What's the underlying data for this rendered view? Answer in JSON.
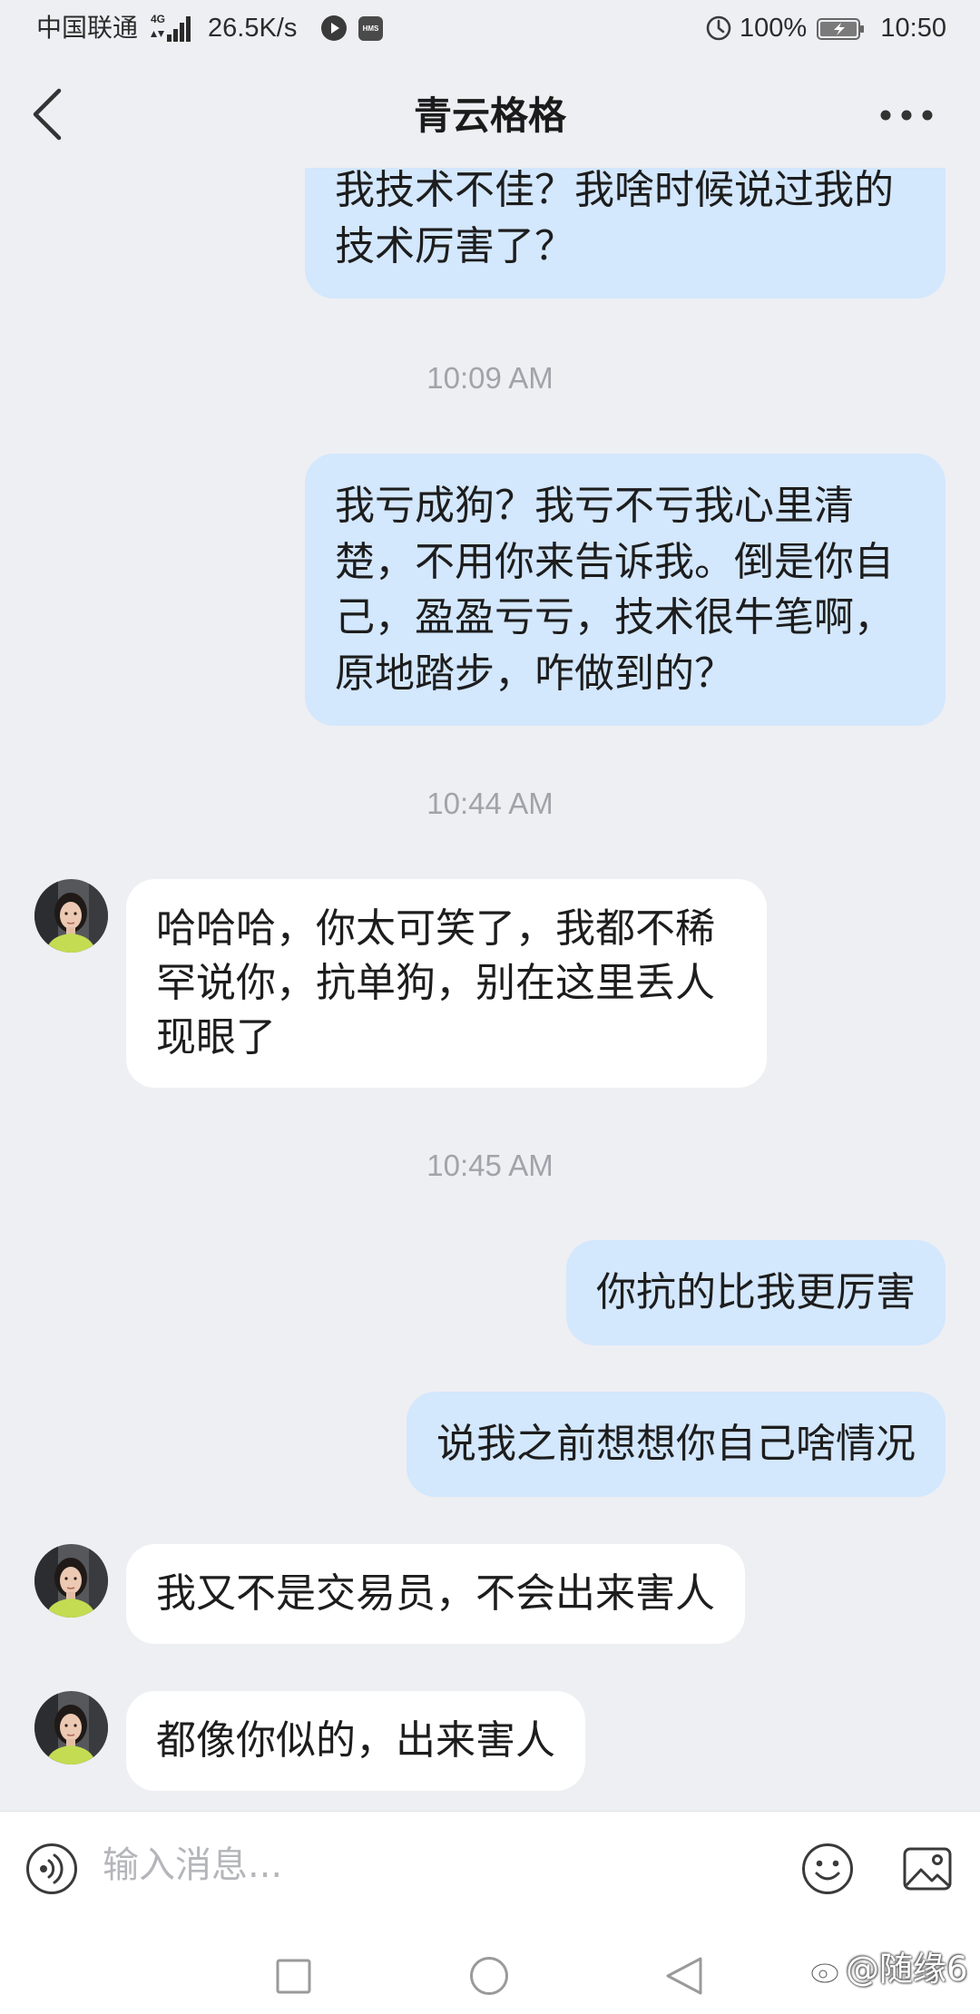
{
  "status_bar": {
    "carrier": "中国联通",
    "network_type": "4G",
    "net_speed": "26.5K/s",
    "hms_badge": "HMS",
    "battery_level": "100%",
    "time": "10:50",
    "icons": [
      "signal-bars-icon",
      "play-icon",
      "hms-icon",
      "data-saver-icon",
      "battery-charging-icon"
    ]
  },
  "header": {
    "title": "青云格格",
    "back_icon": "chevron-left-icon",
    "more_icon": "more-dots-icon"
  },
  "conversation": [
    {
      "sent": "我技术不佳？我啥时候说过我的技术厉害了？"
    },
    {
      "time": "10:09 AM"
    },
    {
      "sent": "我亏成狗？我亏不亏我心里清楚，不用你来告诉我。倒是你自己，盈盈亏亏，技术很牛笔啊，原地踏步，咋做到的？"
    },
    {
      "time": "10:44 AM"
    },
    {
      "received": "哈哈哈，你太可笑了，我都不稀罕说你，抗单狗，别在这里丢人现眼了"
    },
    {
      "time": "10:45 AM"
    },
    {
      "sent": "你抗的比我更厉害"
    },
    {
      "sent": "说我之前想想你自己啥情况"
    },
    {
      "received": "我又不是交易员，不会出来害人"
    },
    {
      "received": "都像你似的，出来害人"
    }
  ],
  "input_bar": {
    "placeholder": "输入消息...",
    "value": "",
    "voice_icon": "voice-icon",
    "emoji_icon": "emoji-icon",
    "image_icon": "image-icon"
  },
  "nav_bar": {
    "icons": [
      "recents-square-icon",
      "home-circle-icon",
      "back-triangle-icon"
    ]
  },
  "watermark": {
    "text": "@随缘6",
    "icon": "weibo-icon"
  },
  "colors": {
    "background": "#EEEFF3",
    "sent_bubble": "#D3E7FD",
    "received_bubble": "#FFFFFF",
    "timestamp": "#A0A4AA",
    "text": "#1D1D1D"
  }
}
